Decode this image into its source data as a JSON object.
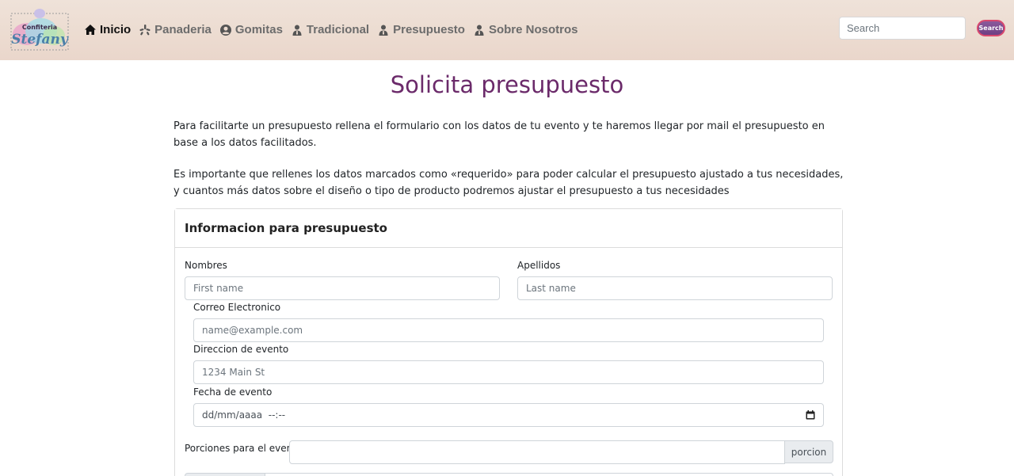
{
  "brand": {
    "logo_top": "Confiteria",
    "logo_main": "Stefany"
  },
  "nav": {
    "items": [
      {
        "label": "Inicio",
        "icon": "home-icon",
        "active": true
      },
      {
        "label": "Panaderia",
        "icon": "yelp-icon",
        "active": false
      },
      {
        "label": "Gomitas",
        "icon": "user-circle-icon",
        "active": false
      },
      {
        "label": "Tradicional",
        "icon": "user-tie-icon",
        "active": false
      },
      {
        "label": "Presupuesto",
        "icon": "user-tie-icon",
        "active": false
      },
      {
        "label": "Sobre Nosotros",
        "icon": "user-tie-icon",
        "active": false
      }
    ],
    "search_placeholder": "Search",
    "search_button": "Search"
  },
  "page": {
    "title": "Solicita presupuesto",
    "intro_1": "Para facilitarte un presupuesto rellena el formulario con los datos de tu evento y te haremos llegar por mail el presupuesto en base a los datos facilitados.",
    "intro_2": "Es importante que rellenes los datos marcados como «requerido» para poder calcular el presupuesto ajustado a tus necesidades, y cuantos más datos sobre el diseño o tipo de producto podremos ajustar el presupuesto a tus necesidades"
  },
  "form": {
    "header": "Informacion para presupuesto",
    "nombres_label": "Nombres",
    "nombres_placeholder": "First name",
    "apellidos_label": "Apellidos",
    "apellidos_placeholder": "Last name",
    "correo_label": "Correo Electronico",
    "correo_placeholder": "name@example.com",
    "direccion_label": "Direccion de evento",
    "direccion_placeholder": "1234 Main St",
    "fecha_label": "Fecha de evento",
    "fecha_value": "dd/mm/aaaa  --:--",
    "porciones_label": "Porciones para el evento",
    "porciones_addon": "porcion"
  },
  "colors": {
    "title": "#6b2a6a",
    "navbar_bg": "#ecdcd1",
    "search_button": "#6e3f84"
  }
}
